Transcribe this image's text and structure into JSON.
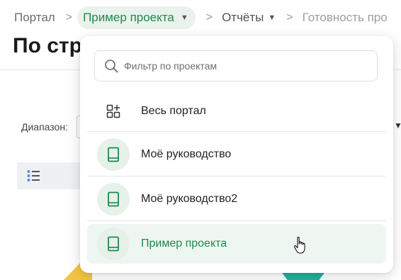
{
  "breadcrumb": {
    "items": [
      {
        "label": "Портал"
      },
      {
        "label": "Пример проекта",
        "has_dropdown": true,
        "active": true
      },
      {
        "label": "Отчёты",
        "has_dropdown": true
      },
      {
        "label": "Готовность про"
      }
    ],
    "separator": ">"
  },
  "page": {
    "title": "По стр"
  },
  "filters": {
    "range_label": "Диапазон:"
  },
  "dropdown": {
    "search": {
      "placeholder": "Фильтр по проектам",
      "value": ""
    },
    "items": [
      {
        "label": "Весь портал",
        "icon": "grid-plus-icon"
      },
      {
        "label": "Моё руководство",
        "icon": "book-icon"
      },
      {
        "label": "Моё руководство2",
        "icon": "book-icon"
      },
      {
        "label": "Пример проекта",
        "icon": "book-icon",
        "selected": true
      }
    ]
  },
  "colors": {
    "accent": "#1f8a4c",
    "accent_bg": "#e9f2ec",
    "selected_bg": "#eef6f1",
    "icon_circle_bg": "#e6f1ea"
  }
}
